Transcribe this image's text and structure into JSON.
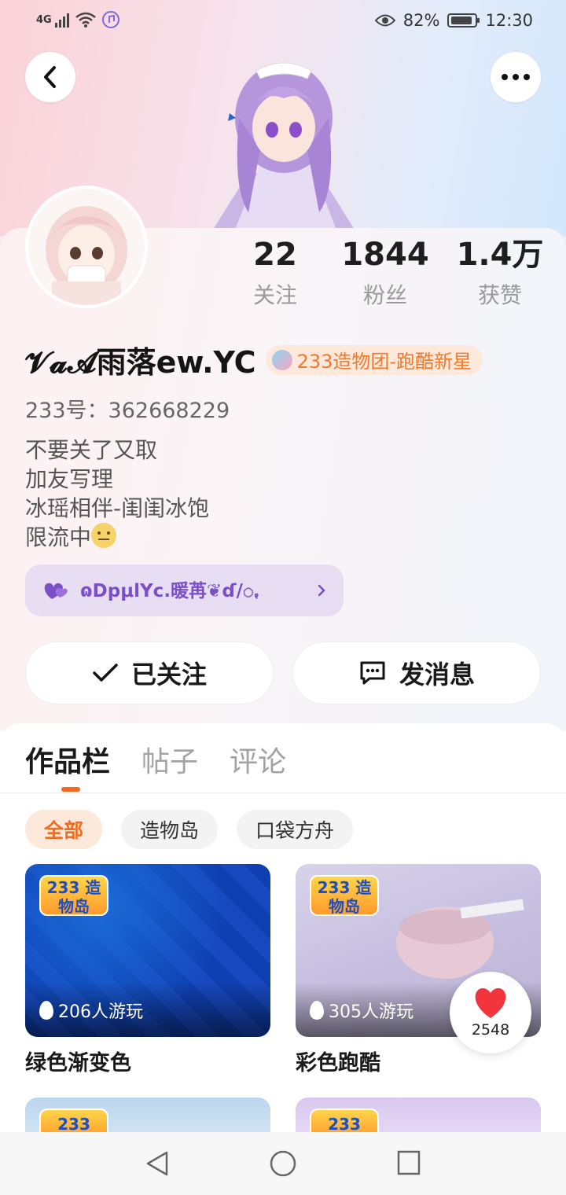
{
  "status_bar": {
    "network": "4G",
    "battery": "82%",
    "time": "12:30"
  },
  "stats": [
    {
      "value": "22",
      "label": "关注"
    },
    {
      "value": "1844",
      "label": "粉丝"
    },
    {
      "value": "1.4万",
      "label": "获赞"
    }
  ],
  "profile": {
    "name": "𝓥𝓪𝓐雨落ew.YC",
    "badge": "233造物团-跑酷新星",
    "id_line": "233号：362668229",
    "bio": [
      "不要关了又取",
      "加友写理",
      "冰瑶相伴-闺闺冰饱",
      "限流中"
    ],
    "cp_link": "ɷDpμlYc.暖苒❦ɗ/ꩻ"
  },
  "actions": {
    "follow_label": "已关注",
    "message_label": "发消息"
  },
  "tabs": [
    "作品栏",
    "帖子",
    "评论"
  ],
  "filters": [
    "全部",
    "造物岛",
    "口袋方舟"
  ],
  "games": [
    {
      "title": "绿色渐变色",
      "plays": "206人游玩",
      "logo": "233 造物岛"
    },
    {
      "title": "彩色跑酷",
      "plays": "305人游玩",
      "logo": "233 造物岛"
    }
  ],
  "row2_logo": "233",
  "like_count": "2548",
  "colors": {
    "accent": "#f26b1d",
    "badge_text": "#f07a2a",
    "cp_chip_bg": "#e7def4",
    "cp_chip_text": "#7b4fc5"
  }
}
